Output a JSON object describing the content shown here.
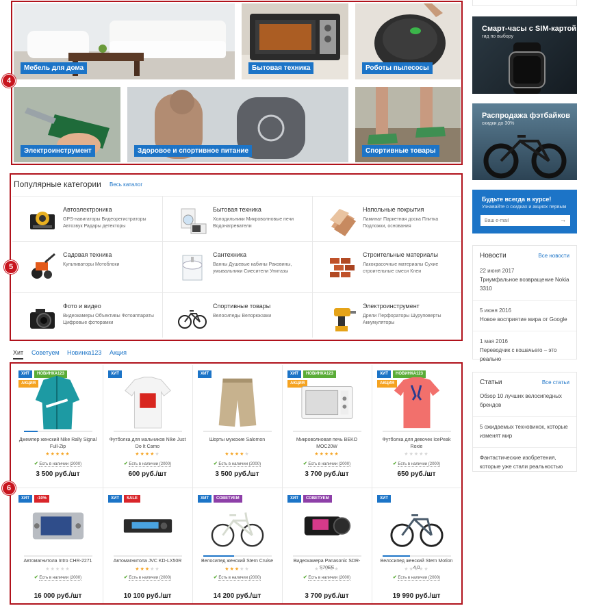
{
  "tiles": [
    {
      "label": "Мебель для дома"
    },
    {
      "label": "Бытовая техника"
    },
    {
      "label": "Роботы пылесосы"
    },
    {
      "label": "Электроинструмент"
    },
    {
      "label": "Здоровое и спортивное питание"
    },
    {
      "label": "Спортивные товары"
    }
  ],
  "markers": [
    "4",
    "5",
    "6"
  ],
  "highlight_color": "#b0121b",
  "accent": "#1c74c7",
  "promos": [
    {
      "title": "Смарт-часы с SIM-картой",
      "subtitle": "гид по выбору"
    },
    {
      "title": "Распродажа фэтбайков",
      "subtitle": "скидки до 30%"
    }
  ],
  "subscribe": {
    "title": "Будьте всегда в курсе!",
    "subtitle": "Узнавайте о скидках и акциях первым",
    "placeholder": "Ваш e-mail"
  },
  "news": {
    "title": "Новости",
    "all": "Все новости",
    "items": [
      {
        "date": "22 июня 2017",
        "text": "Триумфальное возвращение Nokia 3310"
      },
      {
        "date": "5 июня 2016",
        "text": "Новое восприятие мира от Google"
      },
      {
        "date": "1 мая 2016",
        "text": "Переводчик с кошачьего – это реально"
      }
    ]
  },
  "articles": {
    "title": "Статьи",
    "all": "Все статьи",
    "items": [
      {
        "text": "Обзор 10 лучших велосипедных брендов"
      },
      {
        "text": "5 ожидаемых техновинок, которые изменят мир"
      },
      {
        "text": "Фантастические изобретения, которые уже стали реальностью"
      }
    ]
  },
  "popular": {
    "title": "Популярные категории",
    "link": "Весь каталог",
    "cats": [
      {
        "name": "Автоэлектроника",
        "sub": "GPS-навигаторы   Видеорегистраторы   Автозвук   Радары детекторы",
        "icon": "car-audio-icon"
      },
      {
        "name": "Бытовая техника",
        "sub": "Холодильники   Микроволновые печи   Водонагреватели",
        "icon": "appliances-icon"
      },
      {
        "name": "Напольные покрытия",
        "sub": "Ламинат   Паркетная доска   Плитка   Подложки, основания",
        "icon": "flooring-icon"
      },
      {
        "name": "Садовая техника",
        "sub": "Культиваторы   Мотоблоки",
        "icon": "cultivator-icon"
      },
      {
        "name": "Сантехника",
        "sub": "Ванны   Душевые кабины   Раковины, умывальники   Смесители   Унитазы",
        "icon": "sink-icon"
      },
      {
        "name": "Строительные материалы",
        "sub": "Лакокрасочные материалы   Сухие строительные смеси   Клеи",
        "icon": "bricks-icon"
      },
      {
        "name": "Фото и видео",
        "sub": "Видеокамеры   Объективы   Фотоаппараты   Цифровые фоторамки",
        "icon": "camera-icon"
      },
      {
        "name": "Спортивные товары",
        "sub": "Велосипеды   Велорюкзаки",
        "icon": "bicycle-icon"
      },
      {
        "name": "Электроинструмент",
        "sub": "Дрели   Перфораторы   Шуруповерты   Аккумуляторы",
        "icon": "drill-icon"
      }
    ]
  },
  "tabs": [
    "Хит",
    "Советуем",
    "Новинка123",
    "Акция"
  ],
  "availability": "Есть в наличии (2000)",
  "products": [
    {
      "name": "Джемпер женский Nike Rally Signal Full-Zip",
      "price": "3 500 руб./шт",
      "rating": 5,
      "badges": [
        [
          "ХИТ",
          "hit"
        ],
        [
          "НОВИНКА123",
          "new"
        ],
        [
          "АКЦИЯ",
          "act"
        ]
      ],
      "img": "jacket",
      "bar": 0.2
    },
    {
      "name": "Футболка для мальчиков Nike Just Do It Camo",
      "price": "600 руб./шт",
      "rating": 4,
      "badges": [
        [
          "ХИТ",
          "hit"
        ]
      ],
      "img": "tshirt-white",
      "bar": 0
    },
    {
      "name": "Шорты мужские Salomon",
      "price": "3 500 руб./шт",
      "rating": 4,
      "badges": [
        [
          "ХИТ",
          "hit"
        ]
      ],
      "img": "shorts",
      "bar": 0
    },
    {
      "name": "Микроволновая печь BEKO MOC20W",
      "price": "3 700 руб./шт",
      "rating": 5,
      "badges": [
        [
          "ХИТ",
          "hit"
        ],
        [
          "НОВИНКА123",
          "new"
        ],
        [
          "АКЦИЯ",
          "act"
        ]
      ],
      "img": "microwave",
      "bar": 0
    },
    {
      "name": "Футболка для девочек IcePeak Roxie",
      "price": "650 руб./шт",
      "rating": 0,
      "badges": [
        [
          "ХИТ",
          "hit"
        ],
        [
          "НОВИНКА123",
          "new"
        ],
        [
          "АКЦИЯ",
          "act"
        ]
      ],
      "img": "tshirt-pink",
      "bar": 0
    },
    {
      "name": "Автомагнитола Intro CHR-2271",
      "price": "16 000 руб./шт",
      "rating": 0,
      "badges": [
        [
          "ХИТ",
          "hit"
        ],
        [
          "-10%",
          "sale"
        ]
      ],
      "img": "headunit",
      "bar": 0
    },
    {
      "name": "Автомагнитола JVC KD-LX50R",
      "price": "10 100 руб./шт",
      "rating": 3,
      "badges": [
        [
          "ХИТ",
          "hit"
        ],
        [
          "SALE",
          "sale"
        ]
      ],
      "img": "radio",
      "bar": 0
    },
    {
      "name": "Велосипед женский Stern Cruise",
      "price": "14 200 руб./шт",
      "rating": 3,
      "badges": [
        [
          "ХИТ",
          "hit"
        ],
        [
          "СОВЕТУЕМ",
          "adv"
        ]
      ],
      "img": "bike",
      "bar": 0.45
    },
    {
      "name": "Видеокамера Panasonic SDR-S70EE",
      "price": "3 700 руб./шт",
      "rating": 0,
      "badges": [
        [
          "ХИТ",
          "hit"
        ],
        [
          "СОВЕТУЕМ",
          "adv"
        ]
      ],
      "img": "camcorder",
      "bar": 0
    },
    {
      "name": "Велосипед женский Stern Motion 4.0",
      "price": "19 990 руб./шт",
      "rating": 0,
      "badges": [
        [
          "ХИТ",
          "hit"
        ]
      ],
      "img": "bike2",
      "bar": 0.4
    }
  ]
}
